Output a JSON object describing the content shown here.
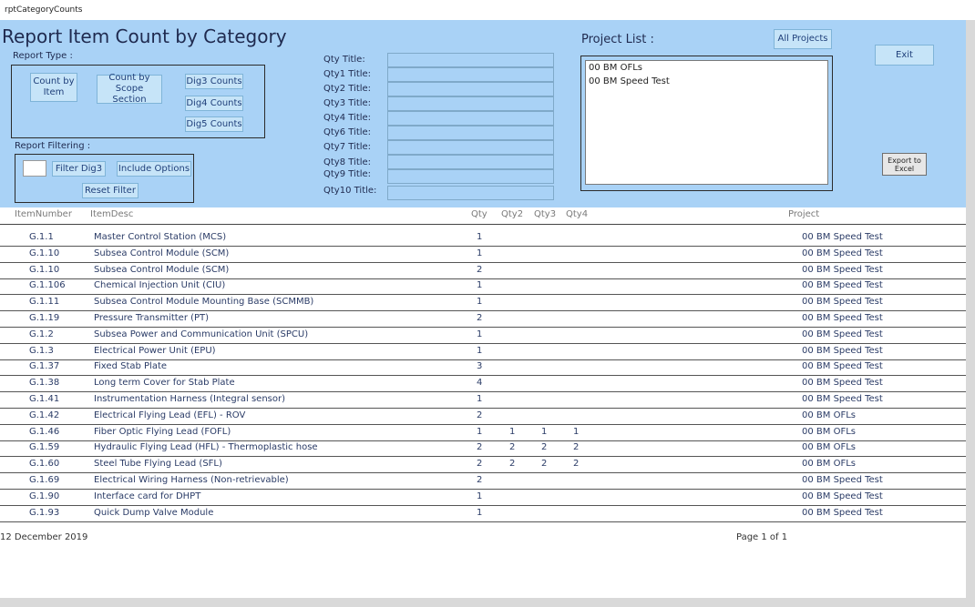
{
  "window": {
    "title": "rptCategoryCounts"
  },
  "header": {
    "title": "Report Item Count by Category",
    "report_type_label": "Report Type :",
    "report_filtering_label": "Report Filtering :",
    "buttons": {
      "count_by_item": "Count by Item",
      "count_by_scope": "Count by Scope Section",
      "dig3": "Dig3 Counts",
      "dig4": "Dig4 Counts",
      "dig5": "Dig5 Counts",
      "filter_dig3": "Filter Dig3",
      "include_options": "Include Options",
      "reset_filter": "Reset Filter",
      "all_projects": "All Projects",
      "exit": "Exit",
      "export_excel": "Export to Excel"
    },
    "qty_titles": [
      "Qty Title:",
      "Qty1 Title:",
      "Qty2 Title:",
      "Qty3 Title:",
      "Qty4 Title:",
      "Qty6 Title:",
      "Qty7 Title:",
      "Qty8 Title:",
      "Qty9 Title:",
      "Qty10 Title:"
    ],
    "project_list_label": "Project List :",
    "project_list_items": [
      "00 BM OFLs",
      "00 BM Speed Test"
    ]
  },
  "table": {
    "columns": [
      "ItemNumber",
      "ItemDesc",
      "Qty",
      "Qty2",
      "Qty3",
      "Qty4",
      "Project"
    ],
    "rows": [
      [
        "G.1.1",
        "Master Control Station (MCS)",
        "1",
        "",
        "",
        "",
        "00 BM Speed Test"
      ],
      [
        "G.1.10",
        "Subsea Control Module (SCM)",
        "1",
        "",
        "",
        "",
        "00 BM Speed Test"
      ],
      [
        "G.1.10",
        "Subsea Control Module (SCM)",
        "2",
        "",
        "",
        "",
        "00 BM Speed Test"
      ],
      [
        "G.1.106",
        "Chemical Injection Unit (CIU)",
        "1",
        "",
        "",
        "",
        "00 BM Speed Test"
      ],
      [
        "G.1.11",
        "Subsea Control Module Mounting Base (SCMMB)",
        "1",
        "",
        "",
        "",
        "00 BM Speed Test"
      ],
      [
        "G.1.19",
        "Pressure Transmitter (PT)",
        "2",
        "",
        "",
        "",
        "00 BM Speed Test"
      ],
      [
        "G.1.2",
        "Subsea Power and Communication Unit (SPCU)",
        "1",
        "",
        "",
        "",
        "00 BM Speed Test"
      ],
      [
        "G.1.3",
        "Electrical Power Unit (EPU)",
        "1",
        "",
        "",
        "",
        "00 BM Speed Test"
      ],
      [
        "G.1.37",
        "Fixed Stab Plate",
        "3",
        "",
        "",
        "",
        "00 BM Speed Test"
      ],
      [
        "G.1.38",
        "Long term Cover for Stab Plate",
        "4",
        "",
        "",
        "",
        "00 BM Speed Test"
      ],
      [
        "G.1.41",
        "Instrumentation Harness (Integral sensor)",
        "1",
        "",
        "",
        "",
        "00 BM Speed Test"
      ],
      [
        "G.1.42",
        "Electrical Flying Lead (EFL) - ROV",
        "2",
        "",
        "",
        "",
        "00 BM OFLs"
      ],
      [
        "G.1.46",
        "Fiber Optic Flying Lead (FOFL)",
        "1",
        "1",
        "1",
        "1",
        "00 BM OFLs"
      ],
      [
        "G.1.59",
        "Hydraulic Flying Lead (HFL) - Thermoplastic hose",
        "2",
        "2",
        "2",
        "2",
        "00 BM OFLs"
      ],
      [
        "G.1.60",
        "Steel Tube Flying Lead (SFL)",
        "2",
        "2",
        "2",
        "2",
        "00 BM OFLs"
      ],
      [
        "G.1.69",
        "Electrical Wiring Harness (Non-retrievable)",
        "2",
        "",
        "",
        "",
        "00 BM Speed Test"
      ],
      [
        "G.1.90",
        "Interface card for DHPT",
        "1",
        "",
        "",
        "",
        "00 BM Speed Test"
      ],
      [
        "G.1.93",
        "Quick Dump Valve Module",
        "1",
        "",
        "",
        "",
        "00 BM Speed Test"
      ]
    ]
  },
  "footer": {
    "date": "12 December 2019",
    "page": "Page 1 of 1"
  },
  "colors": {
    "header_bg": "#a9d2f6",
    "button_bg": "#c6e4f8",
    "row_text": "#2a3b66"
  }
}
